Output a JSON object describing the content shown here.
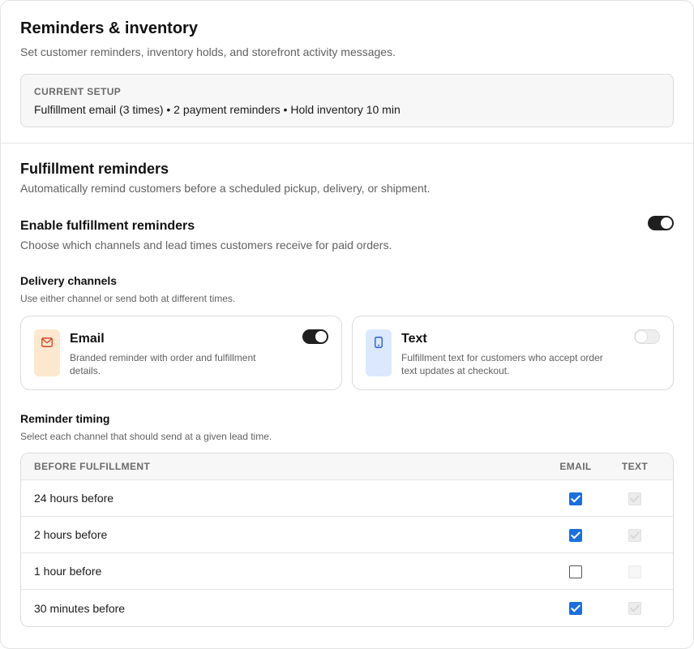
{
  "header": {
    "title": "Reminders & inventory",
    "subtitle": "Set customer reminders, inventory holds, and storefront activity messages.",
    "setup_label": "CURRENT SETUP",
    "setup_text": "Fulfillment email (3 times) • 2 payment reminders • Hold inventory 10 min"
  },
  "fulfillment": {
    "title": "Fulfillment reminders",
    "subtitle": "Automatically remind customers before a scheduled pickup, delivery, or shipment.",
    "enable_title": "Enable fulfillment reminders",
    "enable_sub": "Choose which channels and lead times customers receive for paid orders.",
    "enabled": true
  },
  "channels": {
    "title": "Delivery channels",
    "subtitle": "Use either channel or send both at different times.",
    "email": {
      "title": "Email",
      "desc": "Branded reminder with order and fulfillment details.",
      "icon": "mail-icon",
      "enabled": true
    },
    "text": {
      "title": "Text",
      "desc": "Fulfillment text for customers who accept order text updates at checkout.",
      "icon": "phone-icon",
      "enabled": false
    }
  },
  "timing": {
    "title": "Reminder timing",
    "subtitle": "Select each channel that should send at a given lead time.",
    "columns": [
      "BEFORE FULFILLMENT",
      "EMAIL",
      "TEXT"
    ],
    "rows": [
      {
        "label": "24 hours before",
        "email": true,
        "text": true
      },
      {
        "label": "2 hours before",
        "email": true,
        "text": true
      },
      {
        "label": "1 hour before",
        "email": false,
        "text": false
      },
      {
        "label": "30 minutes before",
        "email": true,
        "text": true
      }
    ]
  },
  "colors": {
    "accent": "#1a6fe0",
    "toggle_on": "#1f1f1f",
    "email_tile": "#fce8cf",
    "text_tile": "#dbe8fd",
    "email_icon": "#d9462a",
    "text_icon": "#2b5fd9"
  }
}
